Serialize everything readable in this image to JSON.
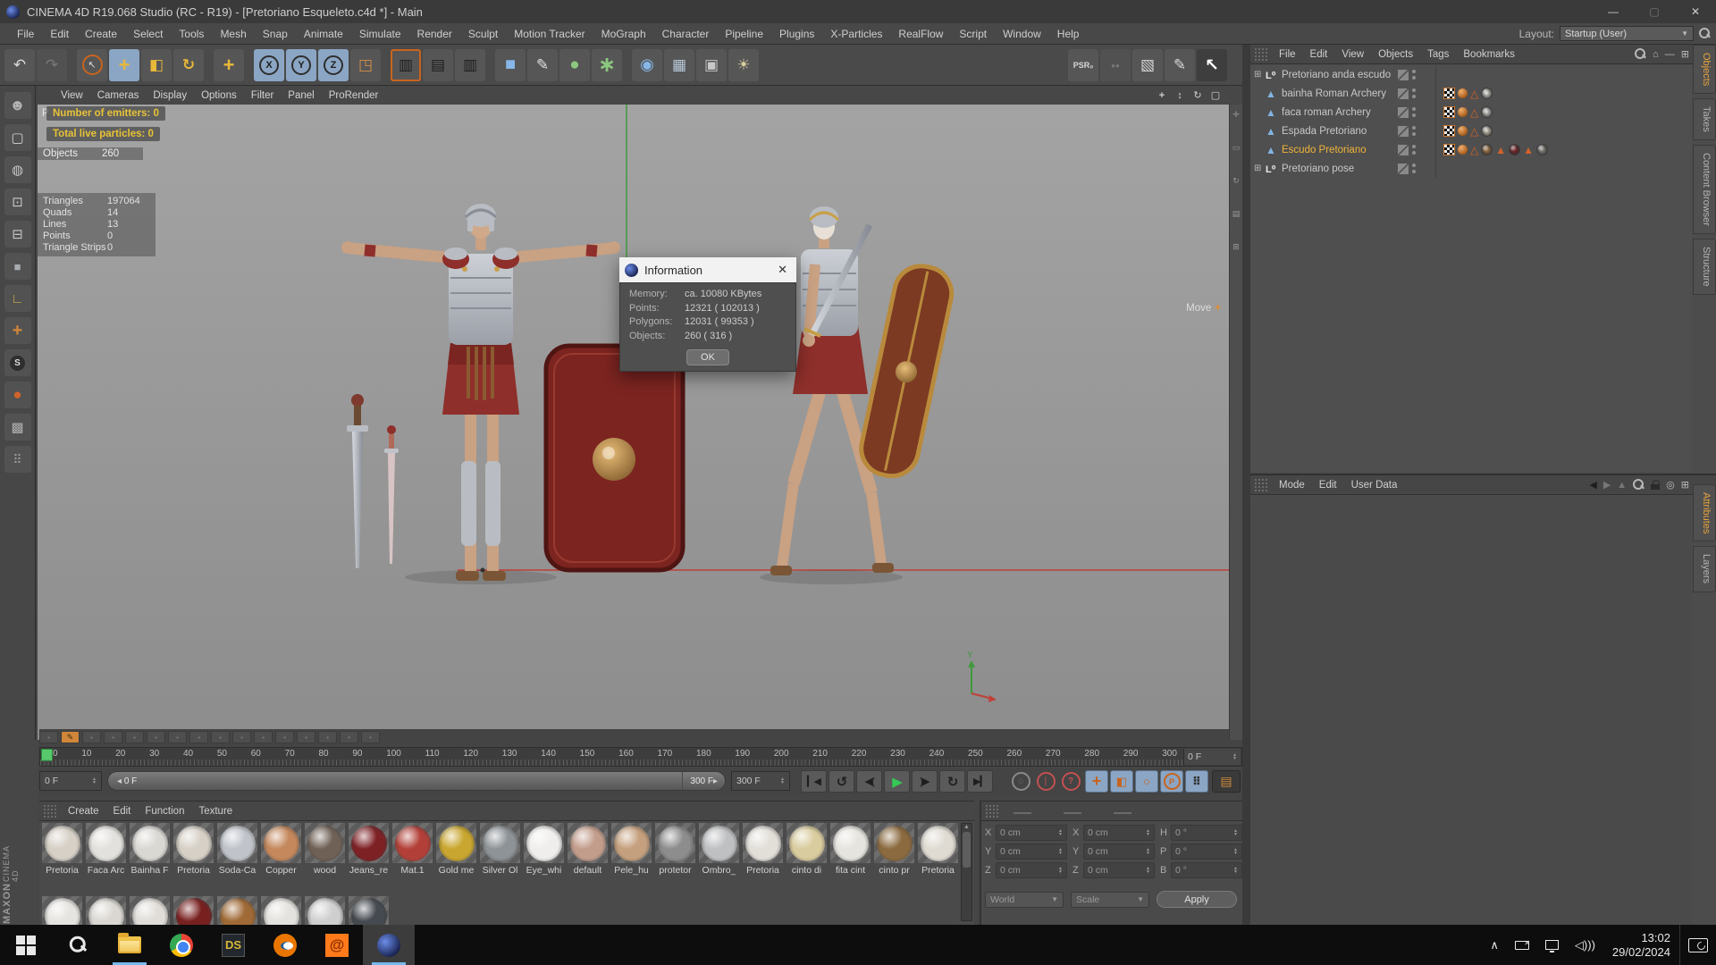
{
  "window": {
    "title": "CINEMA 4D R19.068 Studio (RC - R19) - [Pretoriano Esqueleto.c4d *] - Main"
  },
  "menubar": {
    "items": [
      {
        "label": "File"
      },
      {
        "label": "Edit"
      },
      {
        "label": "Create"
      },
      {
        "label": "Select"
      },
      {
        "label": "Tools"
      },
      {
        "label": "Mesh"
      },
      {
        "label": "Snap"
      },
      {
        "label": "Animate"
      },
      {
        "label": "Simulate"
      },
      {
        "label": "Render"
      },
      {
        "label": "Sculpt"
      },
      {
        "label": "Motion Tracker"
      },
      {
        "label": "MoGraph"
      },
      {
        "label": "Character"
      },
      {
        "label": "Pipeline"
      },
      {
        "label": "Plugins"
      },
      {
        "label": "X-Particles"
      },
      {
        "label": "RealFlow"
      },
      {
        "label": "Script"
      },
      {
        "label": "Window"
      },
      {
        "label": "Help"
      }
    ]
  },
  "layout_chooser": {
    "label": "Layout:",
    "value": "Startup (User)"
  },
  "toolbar": {
    "buttons": [
      {
        "name": "undo-icon",
        "state": "normal"
      },
      {
        "name": "redo-icon",
        "state": "disabled"
      },
      {
        "name": "separator"
      },
      {
        "name": "live-selection-icon",
        "state": "normal"
      },
      {
        "name": "move-tool-icon",
        "state": "active"
      },
      {
        "name": "scale-tool-icon",
        "state": "normal"
      },
      {
        "name": "rotate-tool-icon",
        "state": "normal"
      },
      {
        "name": "separator"
      },
      {
        "name": "last-tool-icon",
        "state": "normal"
      },
      {
        "name": "separator"
      },
      {
        "name": "x-axis-icon",
        "state": "active"
      },
      {
        "name": "y-axis-icon",
        "state": "active"
      },
      {
        "name": "z-axis-icon",
        "state": "active"
      },
      {
        "name": "coord-system-icon",
        "state": "normal"
      },
      {
        "name": "separator"
      },
      {
        "name": "render-view-icon",
        "state": "normal"
      },
      {
        "name": "render-picture-icon",
        "state": "normal"
      },
      {
        "name": "render-settings-icon",
        "state": "normal"
      },
      {
        "name": "separator"
      },
      {
        "name": "primitive-cube-icon",
        "state": "normal"
      },
      {
        "name": "spline-pen-icon",
        "state": "normal"
      },
      {
        "name": "subdivision-icon",
        "state": "normal"
      },
      {
        "name": "modeling-icon",
        "state": "normal"
      },
      {
        "name": "separator"
      },
      {
        "name": "dynamics-icon",
        "state": "normal"
      },
      {
        "name": "floor-icon",
        "state": "normal"
      },
      {
        "name": "camera-icon",
        "state": "normal"
      },
      {
        "name": "light-icon",
        "state": "normal"
      }
    ],
    "right_buttons": [
      {
        "name": "psr-icon",
        "state": "normal"
      },
      {
        "name": "spheres-icon",
        "state": "disabled"
      },
      {
        "name": "image-icon",
        "state": "normal"
      },
      {
        "name": "brush-icon",
        "state": "normal"
      },
      {
        "name": "cursor-icon",
        "state": "normal"
      }
    ]
  },
  "modebar": {
    "buttons": [
      {
        "name": "figure-head-icon"
      },
      {
        "name": "model-mode-icon"
      },
      {
        "name": "texture-mode-icon"
      },
      {
        "name": "points-mode-icon"
      },
      {
        "name": "edges-mode-icon"
      },
      {
        "name": "polygons-mode-icon"
      },
      {
        "name": "workplane-icon"
      },
      {
        "name": "axis-mode-icon"
      },
      {
        "name": "snap-icon"
      },
      {
        "name": "paint-icon"
      },
      {
        "name": "uv-icon"
      },
      {
        "name": "pattern-icon"
      }
    ]
  },
  "viewport": {
    "menu": [
      {
        "label": "View"
      },
      {
        "label": "Cameras"
      },
      {
        "label": "Display"
      },
      {
        "label": "Options"
      },
      {
        "label": "Filter"
      },
      {
        "label": "Panel"
      },
      {
        "label": "ProRender"
      }
    ],
    "view_buttons": [
      {
        "name": "pan-view-icon"
      },
      {
        "name": "zoom-view-icon"
      },
      {
        "name": "rotate-view-icon"
      },
      {
        "name": "toggle-view-icon"
      }
    ],
    "view_label": "P",
    "overlay": {
      "emitters": "Number of emitters: 0",
      "particles": "Total live particles: 0",
      "objects_label": "Objects",
      "objects_value": "260",
      "stats": [
        {
          "label": "Triangles",
          "value": "197064"
        },
        {
          "label": "Quads",
          "value": "14"
        },
        {
          "label": "Lines",
          "value": "13"
        },
        {
          "label": "Points",
          "value": "0"
        },
        {
          "label": "Triangle Strips",
          "value": "0"
        }
      ]
    },
    "tool_hint": "Move",
    "axis_label_y": "Y"
  },
  "dialog": {
    "title": "Information",
    "rows": [
      {
        "label": "Memory:",
        "value": "ca. 10080 KBytes"
      },
      {
        "label": "Points:",
        "value": "12321 ( 102013 )"
      },
      {
        "label": "Polygons:",
        "value": "12031 ( 99353 )"
      },
      {
        "label": "Objects:",
        "value": "260 ( 316 )"
      }
    ],
    "ok_label": "OK"
  },
  "object_manager": {
    "menu": [
      {
        "label": "File"
      },
      {
        "label": "Edit"
      },
      {
        "label": "View"
      },
      {
        "label": "Objects"
      },
      {
        "label": "Tags"
      },
      {
        "label": "Bookmarks"
      }
    ],
    "side_tabs": [
      {
        "label": "Objects",
        "active": true
      },
      {
        "label": "Takes"
      },
      {
        "label": "Content Browser"
      },
      {
        "label": "Structure"
      }
    ],
    "items": [
      {
        "name": "Pretoriano anda escudo",
        "kind": "null",
        "expandable": true,
        "tags": []
      },
      {
        "name": "bainha Roman Archery",
        "kind": "mesh",
        "tags": [
          {
            "type": "checker"
          },
          {
            "type": "phong"
          },
          {
            "type": "tri"
          },
          {
            "type": "mat",
            "color": "#d8d6d0"
          }
        ]
      },
      {
        "name": "faca roman Archery",
        "kind": "mesh",
        "tags": [
          {
            "type": "checker"
          },
          {
            "type": "phong"
          },
          {
            "type": "tri"
          },
          {
            "type": "mat",
            "color": "#d0cec8"
          }
        ]
      },
      {
        "name": "Espada Pretoriano",
        "kind": "mesh",
        "tags": [
          {
            "type": "checker"
          },
          {
            "type": "phong"
          },
          {
            "type": "tri"
          },
          {
            "type": "mat",
            "color": "#cfc8b8"
          }
        ]
      },
      {
        "name": "Escudo Pretoriano",
        "kind": "mesh",
        "selected": true,
        "tags": [
          {
            "type": "checker"
          },
          {
            "type": "phong"
          },
          {
            "type": "tri"
          },
          {
            "type": "mat",
            "color": "#a87848"
          },
          {
            "type": "tri-f"
          },
          {
            "type": "mat",
            "color": "#7e2125"
          },
          {
            "type": "tri-f"
          },
          {
            "type": "mat",
            "color": "#8f8b84"
          }
        ]
      },
      {
        "name": "Pretoriano pose",
        "kind": "null",
        "expandable": true,
        "tags": []
      }
    ]
  },
  "attribute_manager": {
    "menu": [
      {
        "label": "Mode"
      },
      {
        "label": "Edit"
      },
      {
        "label": "User Data"
      }
    ],
    "side_tabs": [
      {
        "label": "Attributes",
        "active": true
      },
      {
        "label": "Layers"
      }
    ]
  },
  "timeline": {
    "ticks": [
      "0",
      "10",
      "20",
      "30",
      "40",
      "50",
      "60",
      "70",
      "80",
      "90",
      "100",
      "110",
      "120",
      "130",
      "140",
      "150",
      "160",
      "170",
      "180",
      "190",
      "200",
      "210",
      "220",
      "230",
      "240",
      "250",
      "260",
      "270",
      "280",
      "290",
      "300"
    ],
    "ruler_spin": "0 F",
    "frame_spin": "0 F",
    "slider_current": "0 F",
    "slider_end": "300 F",
    "end_spin": "300 F",
    "anim_buttons": [
      {
        "state": "dim"
      },
      {
        "state": "orange"
      },
      {
        "state": "dim"
      },
      {
        "state": "dim"
      },
      {
        "state": "dim"
      },
      {
        "state": "dim"
      },
      {
        "state": "dim"
      },
      {
        "state": "dim"
      },
      {
        "state": "dim"
      },
      {
        "state": "dim"
      },
      {
        "state": "dim"
      },
      {
        "state": "dim"
      },
      {
        "state": "dim"
      },
      {
        "state": "dim"
      },
      {
        "state": "dim"
      },
      {
        "state": "dim"
      }
    ],
    "transport": [
      {
        "name": "goto-start-icon"
      },
      {
        "name": "prev-key-icon"
      },
      {
        "name": "prev-frame-icon"
      },
      {
        "name": "play-icon"
      },
      {
        "name": "next-frame-icon"
      },
      {
        "name": "next-key-icon"
      },
      {
        "name": "goto-end-icon"
      }
    ],
    "record_buttons": [
      {
        "name": "record-icon"
      },
      {
        "name": "keyframe-icon"
      },
      {
        "name": "question-icon"
      }
    ],
    "key_toggles": [
      {
        "name": "key-position-icon"
      },
      {
        "name": "key-scale-icon"
      },
      {
        "name": "key-rotation-icon"
      },
      {
        "name": "key-parameter-icon"
      },
      {
        "name": "key-pla-icon"
      }
    ]
  },
  "materials": {
    "menu": [
      {
        "label": "Create"
      },
      {
        "label": "Edit"
      },
      {
        "label": "Function"
      },
      {
        "label": "Texture"
      }
    ],
    "items": [
      {
        "name": "Pretoria",
        "color": "#d6d0c6"
      },
      {
        "name": "Faca Arc",
        "color": "#e3e1dd"
      },
      {
        "name": "Bainha F",
        "color": "#dad8d3"
      },
      {
        "name": "Pretoria",
        "color": "#d6d0c6"
      },
      {
        "name": "Soda-Ca",
        "color": "#c0c4ca"
      },
      {
        "name": "Copper",
        "color": "#c4885c"
      },
      {
        "name": "wood",
        "color": "#6f6156"
      },
      {
        "name": "Jeans_re",
        "color": "#7e2125"
      },
      {
        "name": "Mat.1",
        "color": "#b34038"
      },
      {
        "name": "Gold me",
        "color": "#c9a62f"
      },
      {
        "name": "Silver Ol",
        "color": "#8e9397"
      },
      {
        "name": "Eye_whi",
        "color": "#efeeec"
      },
      {
        "name": "default",
        "color": "#c39d8c"
      },
      {
        "name": "Pele_hu",
        "color": "#c5a07e"
      },
      {
        "name": "protetor",
        "color": "#8d8d8d"
      },
      {
        "name": "Ombro_",
        "color": "#bfc0c2"
      },
      {
        "name": "Pretoria",
        "color": "#e2dfd9"
      },
      {
        "name": "cinto di",
        "color": "#d9cc9e"
      },
      {
        "name": "fita cint",
        "color": "#e6e4de"
      },
      {
        "name": "cinto pr",
        "color": "#8b6a3f"
      },
      {
        "name": "Pretoria",
        "color": "#dfdbd2"
      }
    ],
    "row2": [
      {
        "color": "#e6e4e0"
      },
      {
        "color": "#dad7d2"
      },
      {
        "color": "#e0ddd8"
      },
      {
        "color": "#78201f"
      },
      {
        "color": "#a06a36"
      },
      {
        "color": "#e4e2de"
      },
      {
        "color": "#cfcfcf"
      },
      {
        "color": "#454a50"
      }
    ]
  },
  "coordinates": {
    "columns": [
      {
        "rows": [
          {
            "label": "X",
            "value": "0 cm"
          },
          {
            "label": "Y",
            "value": "0 cm"
          },
          {
            "label": "Z",
            "value": "0 cm"
          }
        ]
      },
      {
        "rows": [
          {
            "label": "X",
            "value": "0 cm"
          },
          {
            "label": "Y",
            "value": "0 cm"
          },
          {
            "label": "Z",
            "value": "0 cm"
          }
        ]
      },
      {
        "rows": [
          {
            "label": "H",
            "value": "0 °"
          },
          {
            "label": "P",
            "value": "0 °"
          },
          {
            "label": "B",
            "value": "0 °"
          }
        ]
      }
    ],
    "world_label": "World",
    "scale_label": "Scale",
    "apply_label": "Apply"
  },
  "branding": {
    "line1": "MAXON",
    "line2": "CINEMA 4D"
  },
  "taskbar": {
    "time": "13:02",
    "date": "29/02/2024"
  },
  "colors": {
    "accent_orange": "#e8a33d",
    "selection_blue": "#8ba6c4",
    "timeline_green": "#57c96c",
    "axis_red": "#c04038",
    "axis_green": "#3f9a3f"
  }
}
